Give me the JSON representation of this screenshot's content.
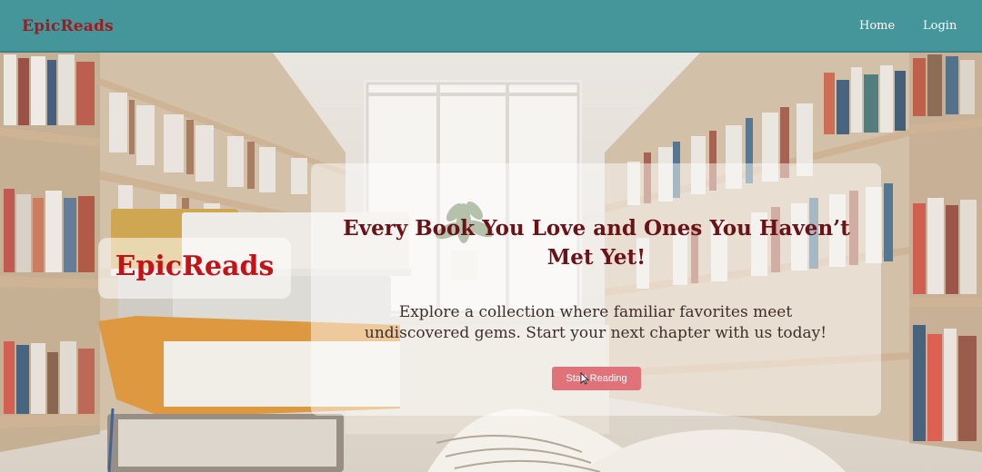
{
  "navbar": {
    "brand": "EpicReads",
    "links": [
      {
        "label": "Home"
      },
      {
        "label": "Login"
      }
    ]
  },
  "hero": {
    "logo_text": "EpicReads",
    "headline_line1": "Every Book You Love and Ones You Haven’t",
    "headline_line2": "Met Yet!",
    "subtext_line1": "Explore a collection where familiar favorites meet",
    "subtext_line2": "undiscovered gems. Start your next chapter with us today!",
    "cta_label": "Start Reading"
  },
  "colors": {
    "navbar_bg": "#45969a",
    "brand": "#9c1c22",
    "headline": "#6a1218",
    "logo": "#c41218",
    "cta_bg": "#e0727a"
  },
  "icons": {
    "cursor": "mouse-pointer-icon"
  }
}
